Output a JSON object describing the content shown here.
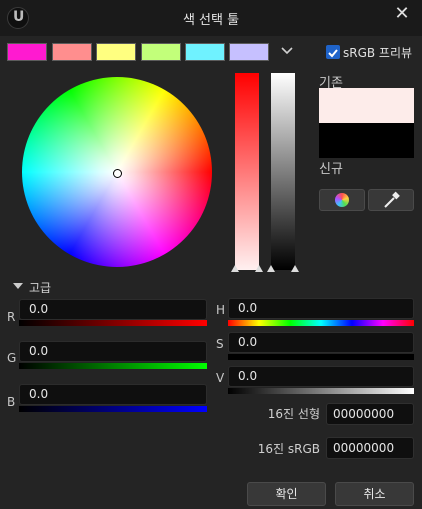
{
  "window": {
    "title": "색 선택 툴",
    "logo_letter": "U"
  },
  "swatches": [
    "#ff1ad0",
    "#ff8e8e",
    "#ffff80",
    "#c2ff7a",
    "#6ff2ff",
    "#c6c0ff"
  ],
  "srgb_preview": {
    "label": "sRGB 프리뷰",
    "checked": true
  },
  "compare": {
    "old_label": "기존",
    "new_label": "신규",
    "old_color": "#fdecea",
    "new_color": "#000000"
  },
  "advanced": {
    "label": "고급"
  },
  "channels": {
    "r": {
      "label": "R",
      "value": "0.0"
    },
    "g": {
      "label": "G",
      "value": "0.0"
    },
    "b": {
      "label": "B",
      "value": "0.0"
    },
    "h": {
      "label": "H",
      "value": "0.0"
    },
    "s": {
      "label": "S",
      "value": "0.0"
    },
    "v": {
      "label": "V",
      "value": "0.0"
    }
  },
  "hex": {
    "linear_label": "16진 선형",
    "linear_value": "00000000",
    "srgb_label": "16진 sRGB",
    "srgb_value": "00000000"
  },
  "buttons": {
    "ok": "확인",
    "cancel": "취소"
  }
}
